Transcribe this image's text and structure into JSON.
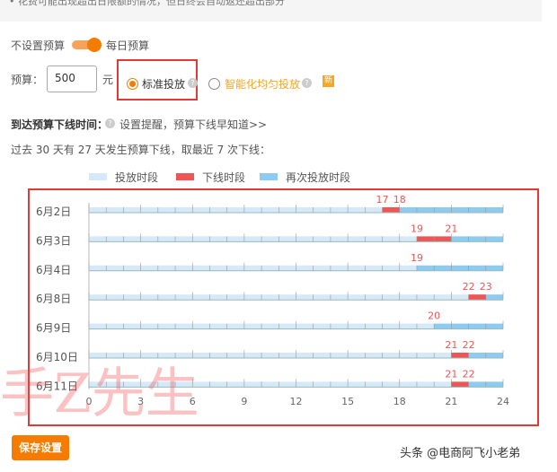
{
  "notice": "• 花费可能出现超出日限额的情况，但日终会自动返还超出部分",
  "budget_toggle": {
    "off_label": "不设置预算",
    "on_label": "每日预算",
    "state": "on"
  },
  "budget": {
    "label": "预算：",
    "value": "500",
    "unit": "元"
  },
  "delivery": {
    "standard": "标准投放",
    "smart": "智能化均匀投放",
    "new_badge": "新",
    "selected": "standard"
  },
  "offline": {
    "title": "到达预算下线时间：",
    "reminder_link": "设置提醒，预算下线早知道>>",
    "summary": "过去 30 天有 27 天发生预算下线，取最近 7 次下线："
  },
  "chart_data": {
    "type": "timeline",
    "legend": [
      "投放时段",
      "下线时段",
      "再次投放时段"
    ],
    "colors": {
      "active": "#d6e9f8",
      "offline": "#f05454",
      "resumed": "#8ecbf0"
    },
    "x_ticks": [
      0,
      3,
      6,
      9,
      12,
      15,
      18,
      21,
      24
    ],
    "xlim": [
      0,
      24
    ],
    "rows": [
      {
        "date": "6月2日",
        "offline_start": 17,
        "offline_end": 18
      },
      {
        "date": "6月3日",
        "offline_start": 19,
        "offline_end": 21
      },
      {
        "date": "6月4日",
        "offline_start": 19,
        "offline_end": 19
      },
      {
        "date": "6月8日",
        "offline_start": 22,
        "offline_end": 23
      },
      {
        "date": "6月9日",
        "offline_start": 20,
        "offline_end": 20
      },
      {
        "date": "6月10日",
        "offline_start": 21,
        "offline_end": 22
      },
      {
        "date": "6月11日",
        "offline_start": 21,
        "offline_end": 22
      }
    ]
  },
  "save_label": "保存设置",
  "watermark": "手Z先生",
  "footer_watermark": "头条 @电商阿飞小老弟"
}
